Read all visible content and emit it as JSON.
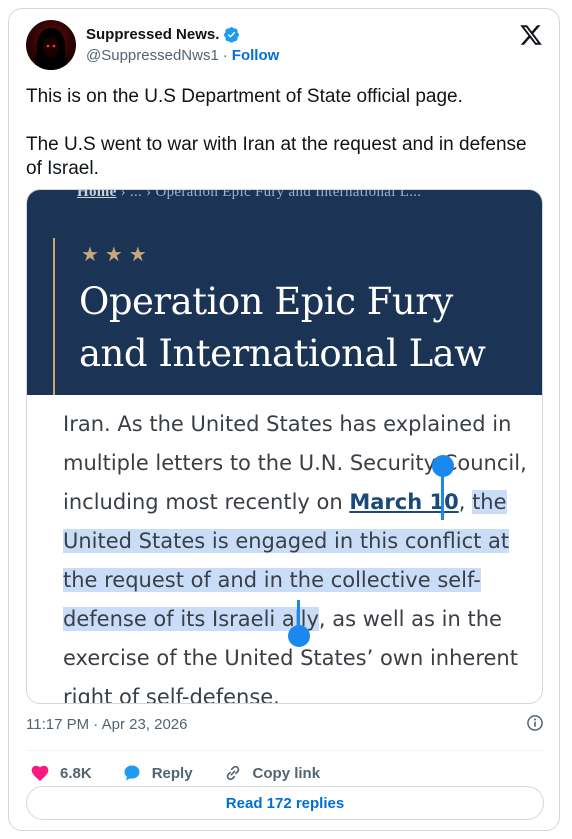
{
  "author": {
    "display_name": "Suppressed News.",
    "handle": "@SuppressedNws1",
    "separator": "·",
    "follow_label": "Follow",
    "verified_color": "#1d9bf0"
  },
  "tweet": {
    "paragraphs": [
      "This is on the U.S Department of State official page.",
      "The U.S went to war with Iran at the request and in defense of Israel."
    ],
    "timestamp": "11:17 PM · Apr 23, 2026"
  },
  "media": {
    "breadcrumb_home": "Home",
    "breadcrumb_rest": "›  ...  ›  Operation Epic Fury and International L...",
    "stars": "★★★",
    "title_line1": "Operation Epic Fury",
    "title_line2": "and International Law",
    "lines": {
      "l1": "Iran. As the United States has explained in",
      "l2": "multiple letters to the U.N. Security Council,",
      "l3a": "including most recently on ",
      "l3link": "March 10",
      "l3b": ", ",
      "l3hl": "the",
      "l4": "United States is engaged in this conflict at",
      "l5": "the request of and in the collective self-",
      "l6hl": "defense of its Israeli ally",
      "l6b": ", as well as in the",
      "l7": "exercise of the United States’ own inherent",
      "l8": "right of self-defense."
    },
    "colors": {
      "banner": "#1b3355",
      "accent_gold": "#c9a777",
      "highlight": "#c9ddf8",
      "selection_handle": "#1a88ef"
    }
  },
  "actions": {
    "likes": "6.8K",
    "reply_label": "Reply",
    "copy_link_label": "Copy link"
  },
  "read_replies_label": "Read 172 replies",
  "icons": [
    "verified-badge-icon",
    "x-logo-icon",
    "info-icon",
    "heart-icon",
    "reply-bubble-icon",
    "link-icon"
  ]
}
